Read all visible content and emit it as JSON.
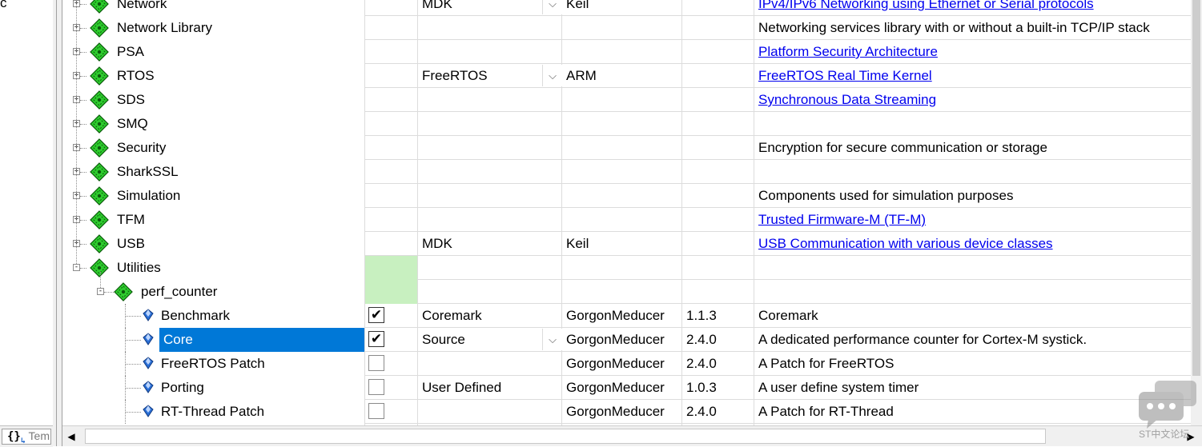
{
  "left_panel": {
    "clipped_text": "c",
    "tab_label": "Tem",
    "tab_icon": "{}"
  },
  "rows": [
    {
      "name": "Network",
      "level": 0,
      "expander": "+",
      "variant": "MDK",
      "dropdown": true,
      "vendor": "Keil",
      "version": "",
      "description": "IPv4/IPv6 Networking using Ethernet or Serial protocols",
      "link": true,
      "check": "none"
    },
    {
      "name": "Network Library",
      "level": 0,
      "expander": "+",
      "variant": "",
      "dropdown": false,
      "vendor": "",
      "version": "",
      "description": "Networking services library with or without a built-in TCP/IP stack",
      "link": false,
      "check": "none"
    },
    {
      "name": "PSA",
      "level": 0,
      "expander": "+",
      "variant": "",
      "dropdown": false,
      "vendor": "",
      "version": "",
      "description": "Platform Security Architecture",
      "link": true,
      "check": "none"
    },
    {
      "name": "RTOS",
      "level": 0,
      "expander": "+",
      "variant": "FreeRTOS",
      "dropdown": true,
      "vendor": "ARM",
      "version": "",
      "description": "FreeRTOS Real Time Kernel",
      "link": true,
      "check": "none"
    },
    {
      "name": "SDS",
      "level": 0,
      "expander": "+",
      "variant": "",
      "dropdown": false,
      "vendor": "",
      "version": "",
      "description": "Synchronous Data Streaming",
      "link": true,
      "check": "none"
    },
    {
      "name": "SMQ",
      "level": 0,
      "expander": "+",
      "variant": "",
      "dropdown": false,
      "vendor": "",
      "version": "",
      "description": "",
      "link": false,
      "check": "none"
    },
    {
      "name": "Security",
      "level": 0,
      "expander": "+",
      "variant": "",
      "dropdown": false,
      "vendor": "",
      "version": "",
      "description": "Encryption for secure communication or storage",
      "link": false,
      "check": "none"
    },
    {
      "name": "SharkSSL",
      "level": 0,
      "expander": "+",
      "variant": "",
      "dropdown": false,
      "vendor": "",
      "version": "",
      "description": "",
      "link": false,
      "check": "none"
    },
    {
      "name": "Simulation",
      "level": 0,
      "expander": "+",
      "variant": "",
      "dropdown": false,
      "vendor": "",
      "version": "",
      "description": "Components used for simulation purposes",
      "link": false,
      "check": "none"
    },
    {
      "name": "TFM",
      "level": 0,
      "expander": "+",
      "variant": "",
      "dropdown": false,
      "vendor": "",
      "version": "",
      "description": "Trusted Firmware-M (TF-M)",
      "link": true,
      "check": "none"
    },
    {
      "name": "USB",
      "level": 0,
      "expander": "+",
      "variant": "MDK",
      "dropdown": false,
      "vendor": "Keil",
      "version": "",
      "description": "USB Communication with various device classes",
      "link": true,
      "check": "none"
    },
    {
      "name": "Utilities",
      "level": 0,
      "expander": "-",
      "variant": "",
      "dropdown": false,
      "vendor": "",
      "version": "",
      "description": "",
      "link": false,
      "check": "green"
    },
    {
      "name": "perf_counter",
      "level": 1,
      "expander": "-",
      "variant": "",
      "dropdown": false,
      "vendor": "",
      "version": "",
      "description": "",
      "link": false,
      "check": "green"
    },
    {
      "name": "Benchmark",
      "level": 2,
      "expander": "",
      "variant": "Coremark",
      "dropdown": false,
      "vendor": "GorgonMeducer",
      "version": "1.1.3",
      "description": "Coremark",
      "link": false,
      "check": "checked"
    },
    {
      "name": "Core",
      "level": 2,
      "expander": "",
      "variant": "Source",
      "dropdown": true,
      "vendor": "GorgonMeducer",
      "version": "2.4.0",
      "description": "A dedicated performance counter for Cortex-M systick.",
      "link": false,
      "check": "checked",
      "selected": true
    },
    {
      "name": "FreeRTOS Patch",
      "level": 2,
      "expander": "",
      "variant": "",
      "dropdown": false,
      "vendor": "GorgonMeducer",
      "version": "2.4.0",
      "description": "A Patch for FreeRTOS",
      "link": false,
      "check": "unchecked"
    },
    {
      "name": "Porting",
      "level": 2,
      "expander": "",
      "variant": "User Defined",
      "dropdown": false,
      "vendor": "GorgonMeducer",
      "version": "1.0.3",
      "description": "A user define system timer",
      "link": false,
      "check": "unchecked"
    },
    {
      "name": "RT-Thread Patch",
      "level": 2,
      "expander": "",
      "variant": "",
      "dropdown": false,
      "vendor": "GorgonMeducer",
      "version": "2.4.0",
      "description": "A Patch for RT-Thread",
      "link": false,
      "check": "unchecked"
    }
  ],
  "watermark": {
    "text": "ST中文论坛"
  },
  "colors": {
    "selection": "#0078d7",
    "green_cell": "#c8f0c0",
    "link": "#0000ee",
    "gem_green": "#2ecc2e"
  }
}
